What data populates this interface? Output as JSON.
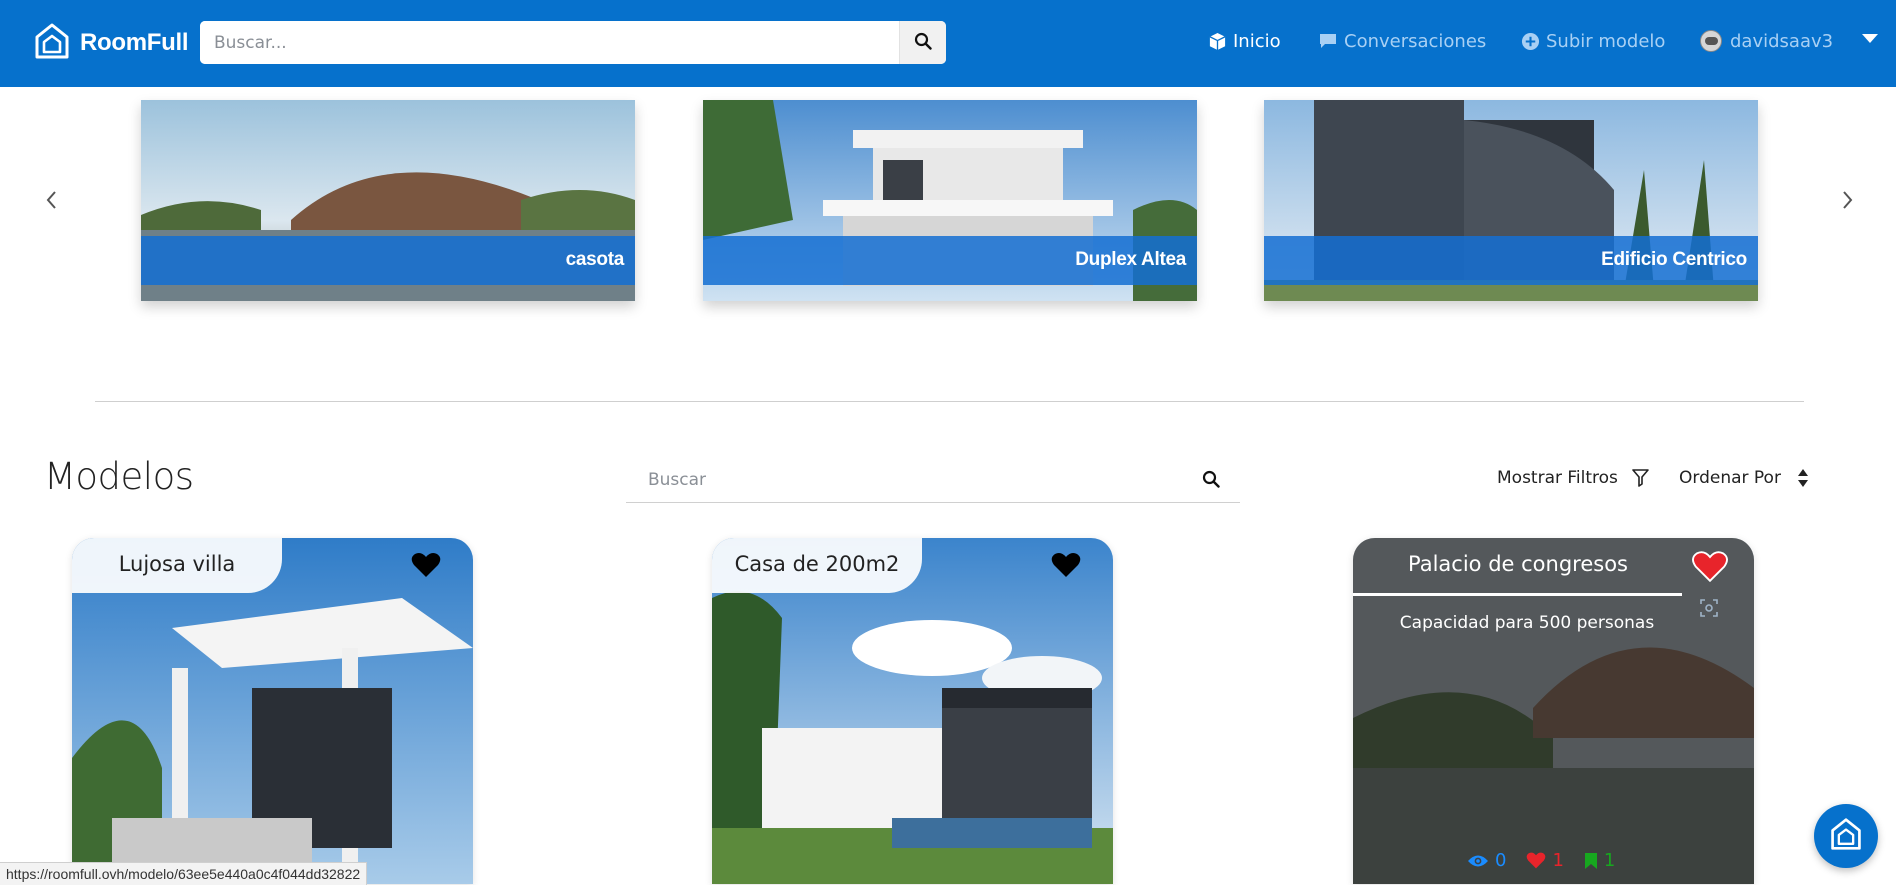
{
  "app": {
    "brand": "RoomFull",
    "search_placeholder": "Buscar...",
    "colors": {
      "primary": "#0671cc",
      "nav_inactive": "#a8d0f4",
      "like_red": "#e8242b",
      "view_blue": "#1a8cff",
      "bookmark_green": "#17a81f"
    }
  },
  "nav": {
    "items": [
      {
        "label": "Inicio",
        "icon": "cube-icon",
        "active": true
      },
      {
        "label": "Conversaciones",
        "icon": "chat-icon",
        "active": false
      },
      {
        "label": "Subir modelo",
        "icon": "plus-circle-icon",
        "active": false
      }
    ],
    "user": {
      "name": "davidsaav3",
      "icon": "avatar"
    }
  },
  "carousel": {
    "slides": [
      {
        "caption": "casota"
      },
      {
        "caption": "Duplex Altea"
      },
      {
        "caption": "Edificio Centrico"
      }
    ]
  },
  "models": {
    "title": "Modelos",
    "search_placeholder": "Buscar",
    "filters_label": "Mostrar Filtros",
    "order_label": "Ordenar Por",
    "cards": [
      {
        "title": "Lujosa villa",
        "liked": false
      },
      {
        "title": "Casa de 200m2",
        "liked": false
      },
      {
        "title": "Palacio de congresos",
        "liked": true,
        "description": "Capacidad para 500 personas",
        "stats": {
          "views": "0",
          "likes": "1",
          "saves": "1"
        }
      }
    ]
  },
  "status_bar": {
    "url": "https://roomfull.ovh/modelo/63ee5e440a0c4f044dd32822"
  }
}
